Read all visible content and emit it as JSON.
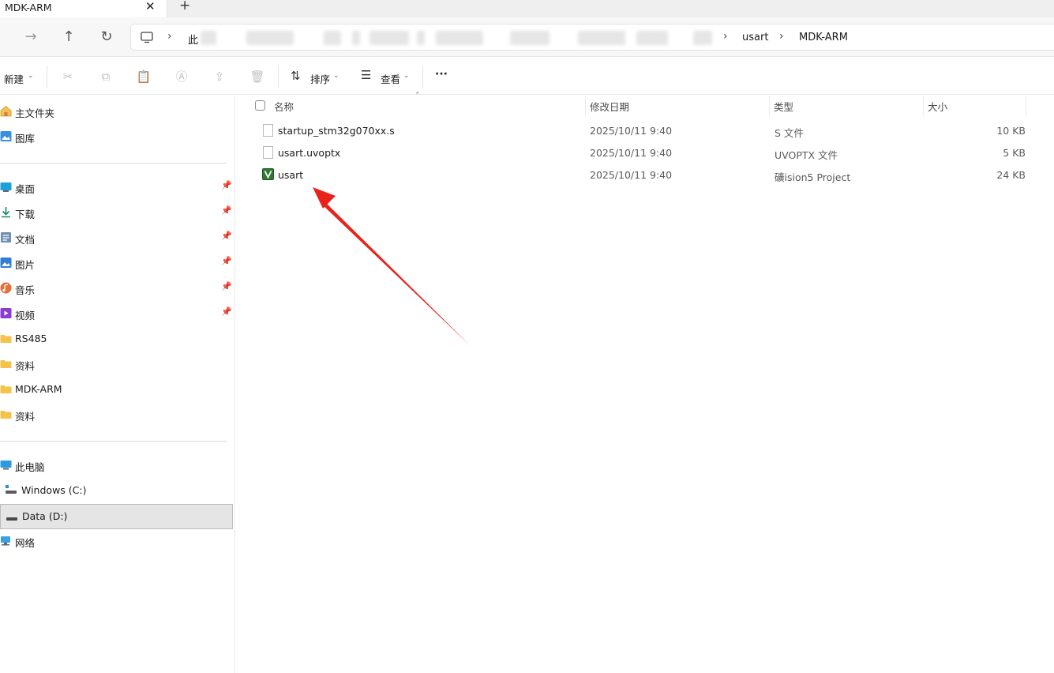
{
  "window": {
    "tab_title": "MDK-ARM",
    "close_glyph": "✕",
    "new_tab_glyph": "+"
  },
  "address": {
    "root_label": "此",
    "crumbs": [
      "usart",
      "MDK-ARM"
    ]
  },
  "toolbar": {
    "new_label": "新建",
    "sort_label": "排序",
    "view_label": "查看",
    "more_label": "···",
    "icons": [
      "cut-icon",
      "copy-icon",
      "paste-icon",
      "rename-icon",
      "share-icon",
      "delete-icon"
    ]
  },
  "sidebar": {
    "quick": [
      {
        "label": "主文件夹",
        "icon": "home-icon"
      },
      {
        "label": "图库",
        "icon": "gallery-icon"
      }
    ],
    "pinned": [
      {
        "label": "桌面",
        "icon": "desktop-icon"
      },
      {
        "label": "下载",
        "icon": "download-icon"
      },
      {
        "label": "文档",
        "icon": "documents-icon"
      },
      {
        "label": "图片",
        "icon": "pictures-icon"
      },
      {
        "label": "音乐",
        "icon": "music-icon"
      },
      {
        "label": "视频",
        "icon": "videos-icon"
      }
    ],
    "folders": [
      {
        "label": "RS485"
      },
      {
        "label": "资料"
      },
      {
        "label": "MDK-ARM"
      },
      {
        "label": "资料"
      }
    ],
    "this_pc": "此电脑",
    "drives": [
      {
        "label": "Windows (C:)"
      },
      {
        "label": "Data (D:)"
      }
    ],
    "network": "网络"
  },
  "list": {
    "headers": {
      "name": "名称",
      "date": "修改日期",
      "type": "类型",
      "size": "大小"
    },
    "files": [
      {
        "name": "startup_stm32g070xx.s",
        "date": "2025/10/11 9:40",
        "type": "S 文件",
        "size": "10 KB",
        "icon": "file-icon"
      },
      {
        "name": "usart.uvoptx",
        "date": "2025/10/11 9:40",
        "type": "UVOPTX 文件",
        "size": "5 KB",
        "icon": "file-icon"
      },
      {
        "name": "usart",
        "date": "2025/10/11 9:40",
        "type": "礦ision5 Project",
        "size": "24 KB",
        "icon": "keil-project-icon"
      }
    ]
  },
  "colors": {
    "accent": "#0067c0",
    "annotation_arrow": "#e8231c",
    "folder": "#f5c24c"
  }
}
